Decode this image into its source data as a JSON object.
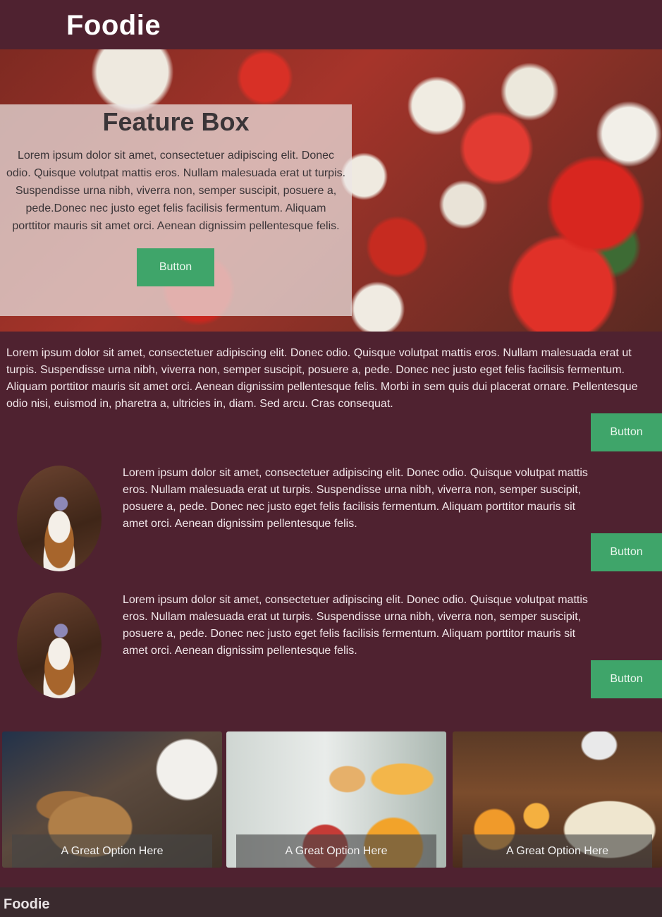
{
  "header": {
    "brand": "Foodie"
  },
  "hero": {
    "title": "Feature Box",
    "text": "Lorem ipsum dolor sit amet, consectetuer adipiscing elit. Donec odio. Quisque volutpat mattis eros. Nullam malesuada erat ut turpis. Suspendisse urna nibh, viverra non, semper suscipit, posuere a, pede.Donec nec justo eget felis facilisis fermentum. Aliquam porttitor mauris sit amet orci. Aenean dignissim pellentesque felis.",
    "button": "Button"
  },
  "intro": {
    "text": "Lorem ipsum dolor sit amet, consectetuer adipiscing elit. Donec odio. Quisque volutpat mattis eros. Nullam malesuada erat ut turpis. Suspendisse urna nibh, viverra non, semper suscipit, posuere a, pede. Donec nec justo eget felis facilisis fermentum. Aliquam porttitor mauris sit amet orci. Aenean dignissim pellentesque felis. Morbi in sem quis dui placerat ornare. Pellentesque odio nisi, euismod in, pharetra a, ultricies in, diam. Sed arcu. Cras consequat.",
    "button": "Button"
  },
  "media": [
    {
      "text": "Lorem ipsum dolor sit amet, consectetuer adipiscing elit. Donec odio. Quisque volutpat mattis eros. Nullam malesuada erat ut turpis. Suspendisse urna nibh, viverra non, semper suscipit, posuere a, pede. Donec nec justo eget felis facilisis fermentum. Aliquam porttitor mauris sit amet orci. Aenean dignissim pellentesque felis.",
      "button": "Button"
    },
    {
      "text": "Lorem ipsum dolor sit amet, consectetuer adipiscing elit. Donec odio. Quisque volutpat mattis eros. Nullam malesuada erat ut turpis. Suspendisse urna nibh, viverra non, semper suscipit, posuere a, pede. Donec nec justo eget felis facilisis fermentum. Aliquam porttitor mauris sit amet orci. Aenean dignissim pellentesque felis.",
      "button": "Button"
    }
  ],
  "cards": [
    {
      "caption": "A Great Option Here"
    },
    {
      "caption": "A Great Option Here"
    },
    {
      "caption": "A Great Option Here"
    }
  ],
  "footer": {
    "brand": "Foodie"
  },
  "colors": {
    "background": "#4f2230",
    "button": "#3fa56a",
    "footer": "#3a2a2e"
  }
}
